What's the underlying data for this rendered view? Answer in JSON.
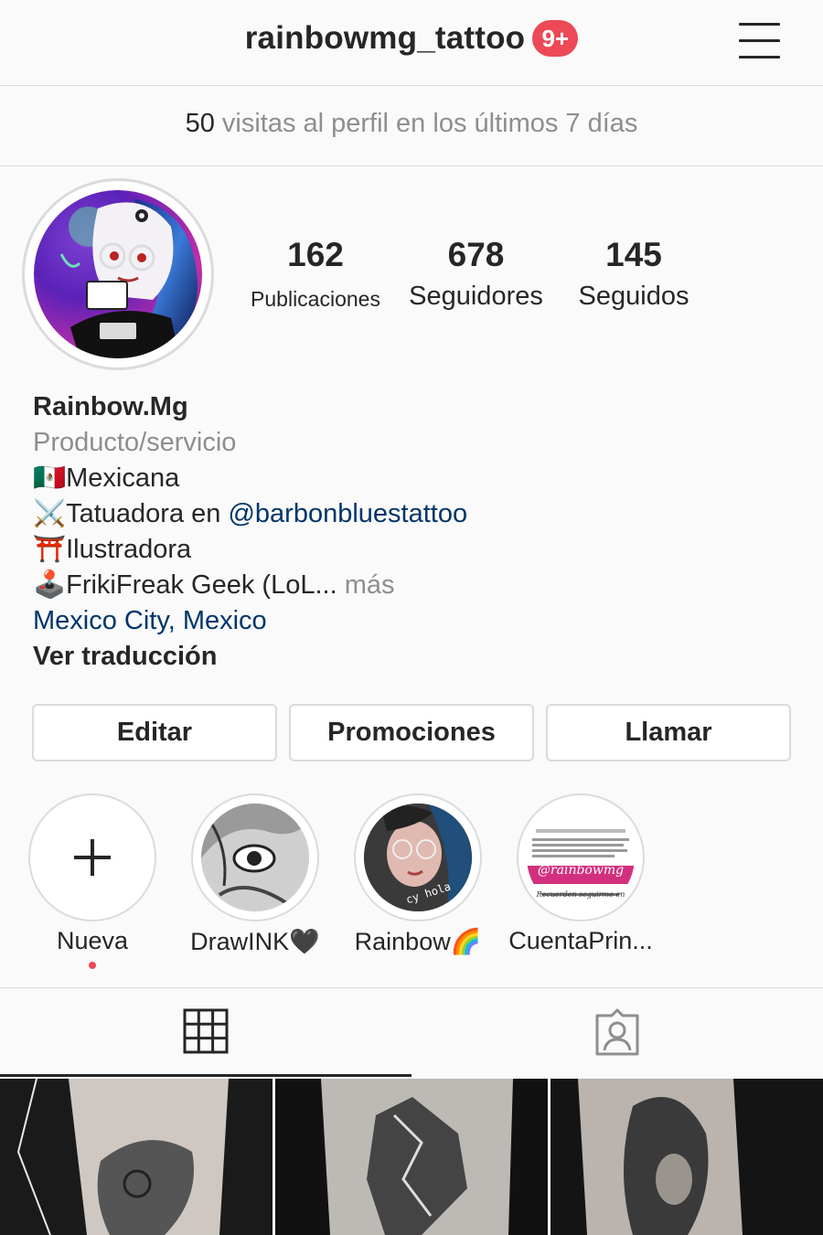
{
  "header": {
    "username": "rainbowmg_tattoo",
    "notification_badge": "9+",
    "menu_icon": "hamburger-menu-icon"
  },
  "insights": {
    "count": "50",
    "text": " visitas al perfil en los últimos 7 días"
  },
  "stats": {
    "posts": {
      "value": "162",
      "label": "Publicaciones"
    },
    "followers": {
      "value": "678",
      "label": "Seguidores"
    },
    "following": {
      "value": "145",
      "label": "Seguidos"
    }
  },
  "bio": {
    "name": "Rainbow.Mg",
    "category": "Producto/servicio",
    "line1_emoji": "🇲🇽",
    "line1_text": "Mexicana",
    "line2_emoji": "⚔️",
    "line2_text": "Tatuadora en ",
    "line2_mention": "@barbonbluestattoo",
    "line3_emoji": "⛩️",
    "line3_text": "Ilustradora",
    "line4_emoji": "🕹️",
    "line4_text": "FrikiFreak Geek (LoL...",
    "line4_more": " más",
    "location": "Mexico City, Mexico",
    "translate": "Ver traducción"
  },
  "buttons": {
    "edit": "Editar",
    "promotions": "Promociones",
    "call": "Llamar"
  },
  "highlights": [
    {
      "label": "Nueva"
    },
    {
      "label": "DrawINK🖤"
    },
    {
      "label": "Rainbow🌈"
    },
    {
      "label": "CuentaPrin..."
    }
  ],
  "highlight_texts": {
    "rainbow_caption": "cy hola",
    "cuenta_handle": "@rainbowmg",
    "cuenta_caption": "Recuerden seguirme en"
  },
  "tabs": {
    "grid_icon": "grid-icon",
    "tagged_icon": "tagged-person-icon"
  },
  "colors": {
    "badge": "#ed4956",
    "link": "#003569",
    "muted": "#8e8e8e",
    "border": "#dbdbdb"
  }
}
